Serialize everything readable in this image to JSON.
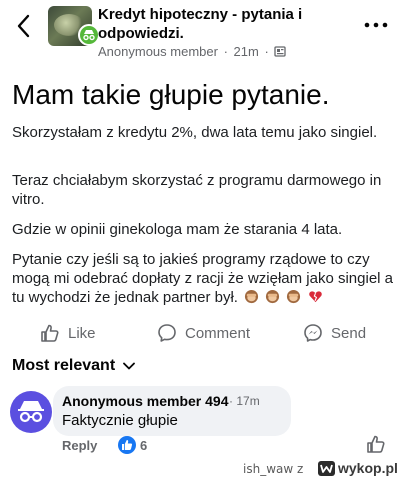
{
  "header": {
    "group_name": "Kredyt hipoteczny - pytania i odpowiedzi.",
    "author": "Anonymous member",
    "time": "21m"
  },
  "post": {
    "title": "Mam takie głupie pytanie.",
    "paragraphs": [
      "Skorzystałam z kredytu 2%, dwa lata temu jako singiel.",
      "Teraz chciałabym skorzystać z programu darmowego in vitro.",
      "Gdzie w opinii ginekologa mam że starania 4 lata.",
      "Pytanie czy jeśli są to jakieś programy rządowe to czy mogą mi odebrać dopłaty z racji że wzięłam jako singiel a tu wychodzi że jednak partner był."
    ],
    "emojis": [
      "see-no-evil-monkey",
      "see-no-evil-monkey",
      "see-no-evil-monkey",
      "broken-heart"
    ]
  },
  "actions": {
    "like": "Like",
    "comment": "Comment",
    "send": "Send"
  },
  "comments_sort": "Most relevant",
  "comment": {
    "author": "Anonymous member 494",
    "time": "17m",
    "text": "Faktycznie głupie",
    "reply": "Reply",
    "reactions": "6"
  },
  "watermark": {
    "user": "ish_waw z",
    "site": "wykop.pl"
  },
  "colors": {
    "accent": "#1877f2",
    "avatar": "#5b4fe0",
    "group_badge": "#55b83a",
    "muted": "#65676b"
  }
}
